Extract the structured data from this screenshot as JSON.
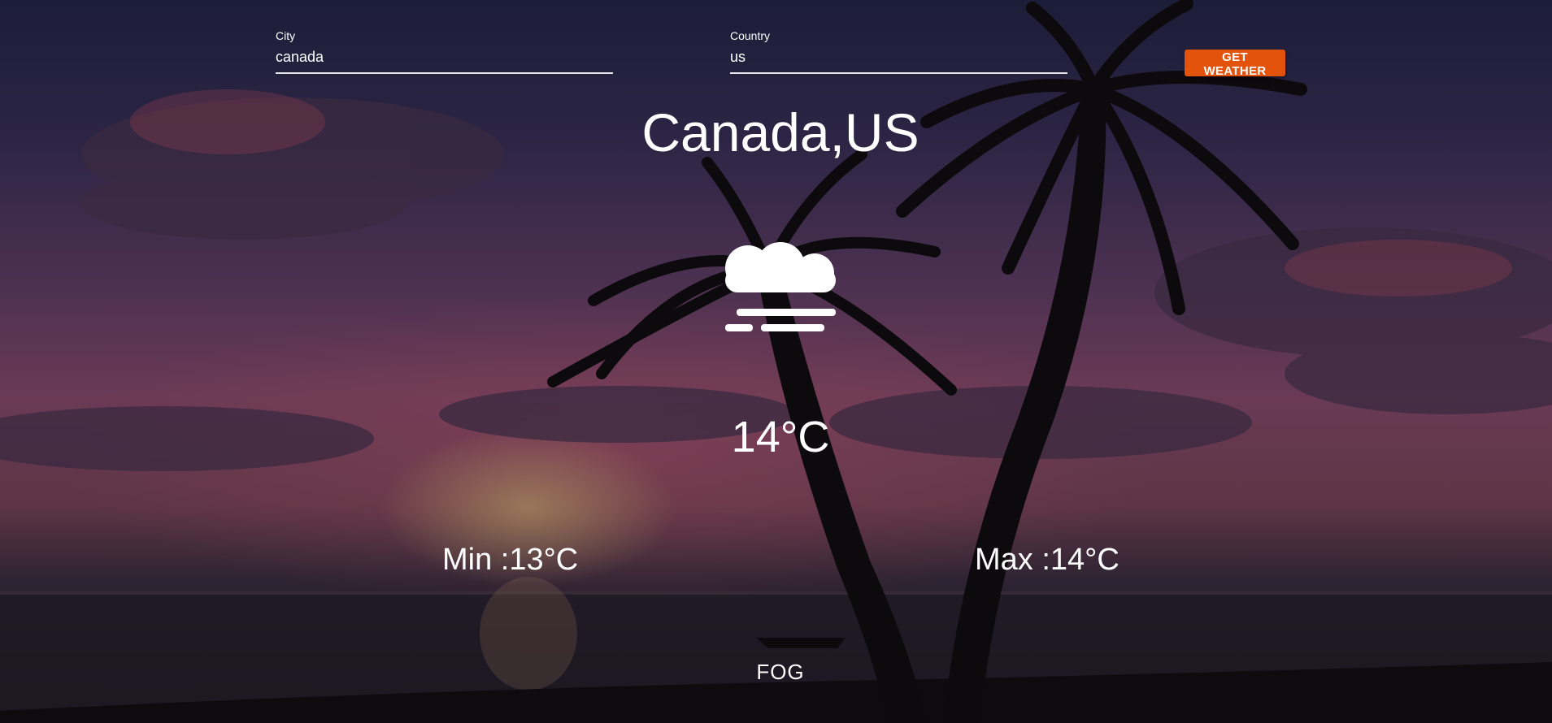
{
  "search": {
    "city_label": "City",
    "city_value": "canada",
    "country_label": "Country",
    "country_value": "us",
    "button_label": "GET WEATHER"
  },
  "weather": {
    "location": "Canada,US",
    "icon": "fog-icon",
    "temperature": "14°C",
    "min": "Min :13°C",
    "max": "Max :14°C",
    "condition": "FOG"
  },
  "colors": {
    "button": "#e3530c",
    "text": "#ffffff"
  }
}
